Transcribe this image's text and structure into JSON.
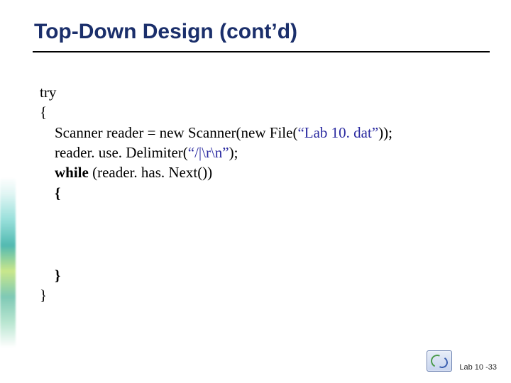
{
  "title": "Top-Down Design (cont’d)",
  "code": {
    "l1": "try",
    "l2": "{",
    "l3_a": "    Scanner reader = new Scanner(new File(",
    "l3_str": "“Lab 10. dat”",
    "l3_b": "));",
    "l4_a": "    reader. use. Delimiter(",
    "l4_str": "“/|\\r\\n”",
    "l4_b": ");",
    "l5_a": "    while",
    "l5_b": " (reader. has. Next())",
    "l6": "    {",
    "l7": "    }",
    "l8": "}"
  },
  "footer": {
    "page": "Lab 10 -33"
  },
  "colors": {
    "title": "#1b2f6b",
    "string_literal": "#2a2aa0"
  }
}
